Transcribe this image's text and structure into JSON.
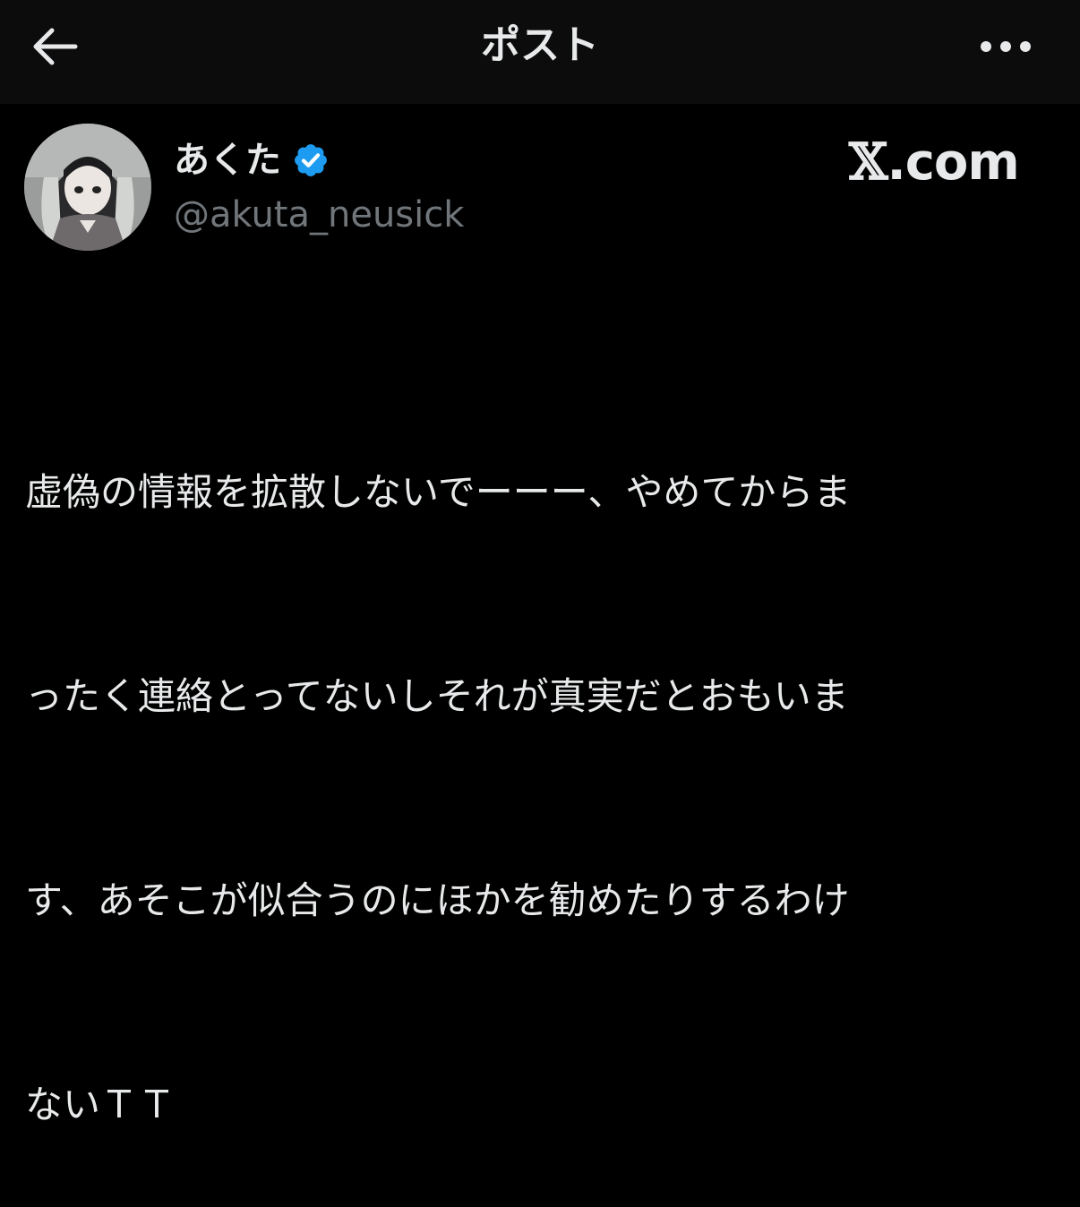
{
  "header": {
    "title": "ポスト",
    "back_icon": "arrow-left-icon",
    "more_icon": "more-horizontal-icon"
  },
  "author": {
    "display_name": "あくた",
    "verified_icon": "verified-badge-icon",
    "handle": "@akuta_neusick"
  },
  "watermark": {
    "x_mark": "𝕏",
    "domain": ".com"
  },
  "post": {
    "lines": [
      "虚偽の情報を拡散しないでーーー、やめてからま",
      "ったく連絡とってないしそれが真実だとおもいま",
      "す、あそこが似合うのにほかを勧めたりするわけ",
      "ないＴＴ"
    ]
  },
  "colors": {
    "background": "#000000",
    "header_background": "#0c0c0c",
    "text_primary": "#e7e9ea",
    "text_secondary": "#71767b",
    "verified_blue": "#1d9bf0"
  }
}
